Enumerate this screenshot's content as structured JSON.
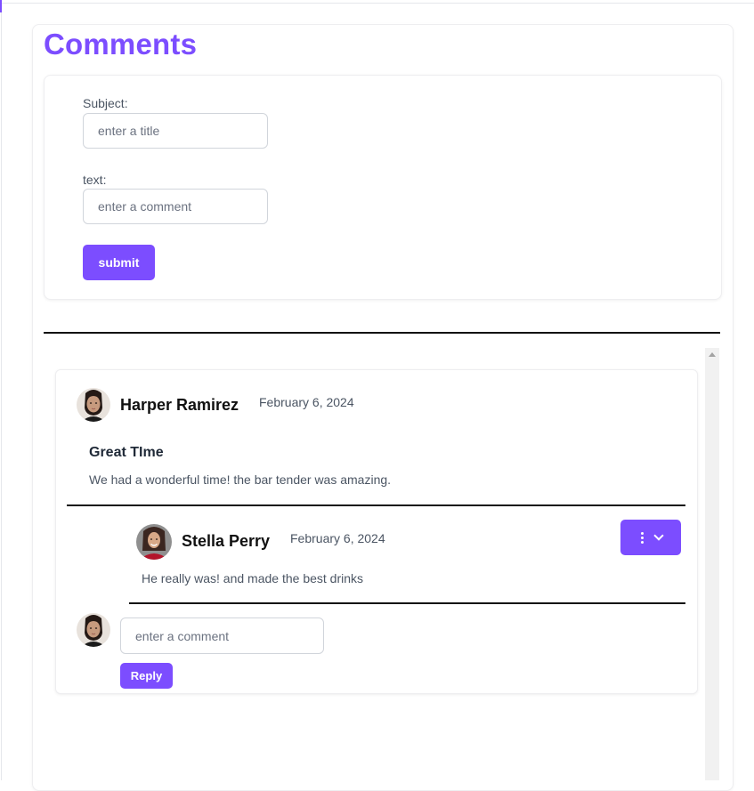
{
  "page": {
    "title": "Comments"
  },
  "form": {
    "subject_label": "Subject:",
    "subject_placeholder": "enter a title",
    "text_label": "text:",
    "text_placeholder": "enter a comment",
    "submit_label": "submit"
  },
  "thread": {
    "comment": {
      "author": "Harper Ramirez",
      "date": "February 6, 2024",
      "subject": "Great TIme",
      "body": "We had a wonderful time! the bar tender was amazing."
    },
    "reply": {
      "author": "Stella Perry",
      "date": "February 6, 2024",
      "body": "He really was! and made the best drinks"
    },
    "reply_form": {
      "placeholder": "enter a comment",
      "button_label": "Reply"
    }
  },
  "colors": {
    "accent": "#7c4dff",
    "divider": "#111111"
  },
  "icons": {
    "menu": "kebab-vertical-icon",
    "chevron": "chevron-down-icon"
  }
}
